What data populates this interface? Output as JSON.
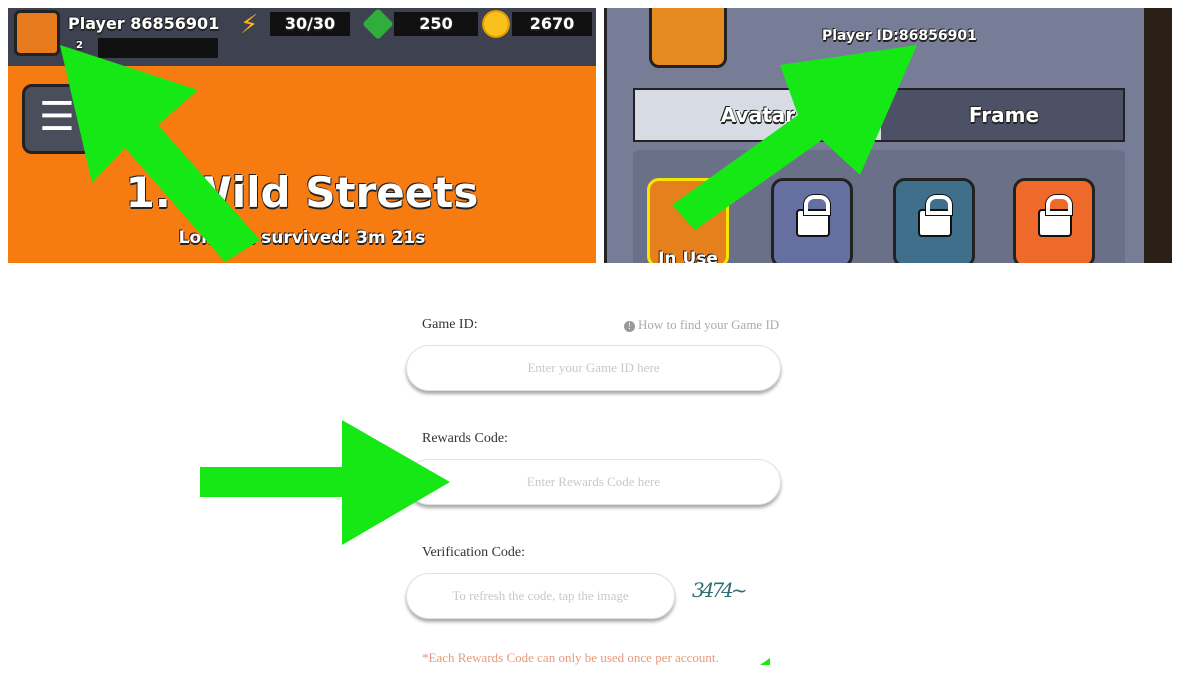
{
  "hud": {
    "player_name": "Player 86856901",
    "level": "2",
    "energy": "30/30",
    "gems": "250",
    "coins": "2670",
    "stage_title": "1. Wild Streets",
    "longest_survived": "Longest survived: 3m 21s"
  },
  "profile": {
    "player_id": "Player ID:86856901",
    "tabs": [
      {
        "label": "Avatar",
        "active": true
      },
      {
        "label": "Frame",
        "active": false
      }
    ],
    "avatars": [
      {
        "status": "In Use",
        "locked": false
      },
      {
        "locked": true
      },
      {
        "locked": true
      },
      {
        "locked": true
      }
    ]
  },
  "form": {
    "game_id_label": "Game ID:",
    "how_to_find": "How to find your Game ID",
    "game_id_placeholder": "Enter your Game ID here",
    "rewards_label": "Rewards Code:",
    "rewards_placeholder": "Enter Rewards Code here",
    "verification_label": "Verification Code:",
    "verification_placeholder": "To refresh the code, tap the image",
    "captcha": "3474",
    "note": "*Each Rewards Code can only be used once per account."
  },
  "colors": {
    "arrow": "#16e816",
    "orange": "#f67c12",
    "note": "#e79a7a"
  }
}
